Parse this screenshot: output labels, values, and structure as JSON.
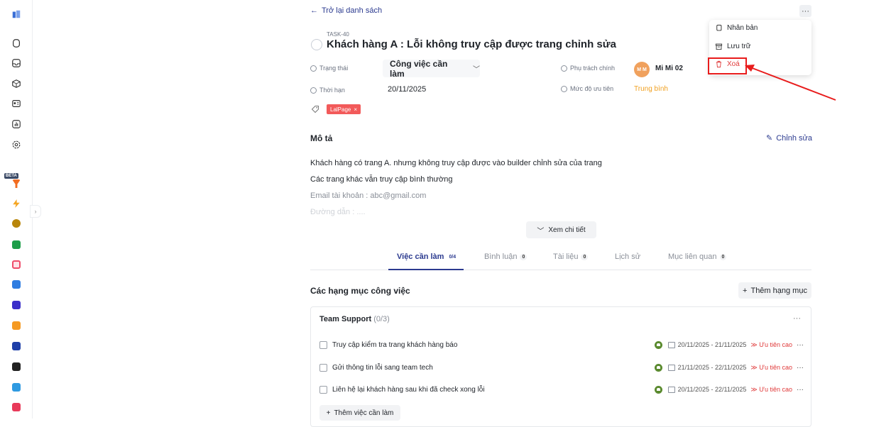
{
  "sidebar": {
    "beta_label": "BETA",
    "items": [
      {
        "icon": "building-icon"
      },
      {
        "icon": "cube-outline-icon"
      },
      {
        "icon": "inbox-icon"
      },
      {
        "icon": "box-icon"
      },
      {
        "icon": "id-card-icon"
      },
      {
        "icon": "chart-icon"
      },
      {
        "icon": "settings-icon"
      }
    ],
    "apps": [
      {
        "icon": "funnel-app-icon",
        "color": "#f26d21"
      },
      {
        "icon": "bolt-app-icon",
        "color": "#f5a623"
      },
      {
        "icon": "globe-app-icon",
        "color": "#b8860b"
      },
      {
        "icon": "store-app-icon",
        "color": "#1e9e4a"
      },
      {
        "icon": "link-app-icon",
        "color": "#ef4c6a"
      },
      {
        "icon": "doc-app-icon",
        "color": "#2f7de1"
      },
      {
        "icon": "note-app-icon",
        "color": "#3b2fc9"
      },
      {
        "icon": "ticket-app-icon",
        "color": "#f59a23"
      },
      {
        "icon": "cc-app-icon",
        "color": "#1f3fa8"
      },
      {
        "icon": "film-app-icon",
        "color": "#222222"
      },
      {
        "icon": "edit-app-icon",
        "color": "#2f9ae1"
      },
      {
        "icon": "record-app-icon",
        "color": "#e83a5a"
      }
    ]
  },
  "header": {
    "back_label": "Trở lại danh sách",
    "more_label": "···"
  },
  "task": {
    "id": "TASK-40",
    "title": "Khách hàng A : Lỗi không truy cập được trang chỉnh sửa",
    "status_label": "Trạng thái",
    "status_value": "Công việc cần làm",
    "deadline_label": "Thời hạn",
    "deadline_value": "20/11/2025",
    "assignee_label": "Phụ trách chính",
    "assignee_initials": "M M",
    "assignee_name": "Mi Mi 02",
    "priority_label": "Mức độ ưu tiên",
    "priority_value": "Trung bình",
    "tag": "LalPage",
    "tag_close": "×"
  },
  "menu": {
    "items": [
      "Nhân bản",
      "Lưu trữ",
      "Xoá"
    ]
  },
  "description": {
    "title": "Mô tả",
    "edit_label": "Chỉnh sửa",
    "lines": [
      "Khách hàng có trang A. nhưng không truy cập được vào builder chỉnh sửa của trang",
      "Các trang khác vẫn truy cập bình thường",
      "Email tài khoản : abc@gmail.com",
      "Đường dẫn : ...."
    ],
    "see_more": "Xem chi tiết"
  },
  "tabs": [
    {
      "label": "Việc cần làm",
      "count": "0/4"
    },
    {
      "label": "Bình luận",
      "count": "0"
    },
    {
      "label": "Tài liệu",
      "count": "0"
    },
    {
      "label": "Lịch sử",
      "count": ""
    },
    {
      "label": "Mục liên quan",
      "count": "0"
    }
  ],
  "checklist": {
    "title": "Các hạng mục công việc",
    "add_category": "Thêm hạng mục",
    "group_name": "Team Support",
    "group_progress": "(0/3)",
    "group_more": "···",
    "tasks": [
      {
        "name": "Truy cập kiểm tra trang khách hàng báo",
        "dates": "20/11/2025 - 21/11/2025",
        "priority": "Ưu tiên cao"
      },
      {
        "name": "Gửi thông tin lỗi sang team tech",
        "dates": "21/11/2025 - 22/11/2025",
        "priority": "Ưu tiên cao"
      },
      {
        "name": "Liên hệ lại khách hàng sau khi đã check xong lỗi",
        "dates": "20/11/2025 - 22/11/2025",
        "priority": "Ưu tiên cao"
      }
    ],
    "row_more": "···",
    "add_task": "Thêm việc cần làm"
  },
  "colors": {
    "accent": "#2b3a8f",
    "danger": "#e03b3b",
    "highlight": "#e81c1c"
  }
}
